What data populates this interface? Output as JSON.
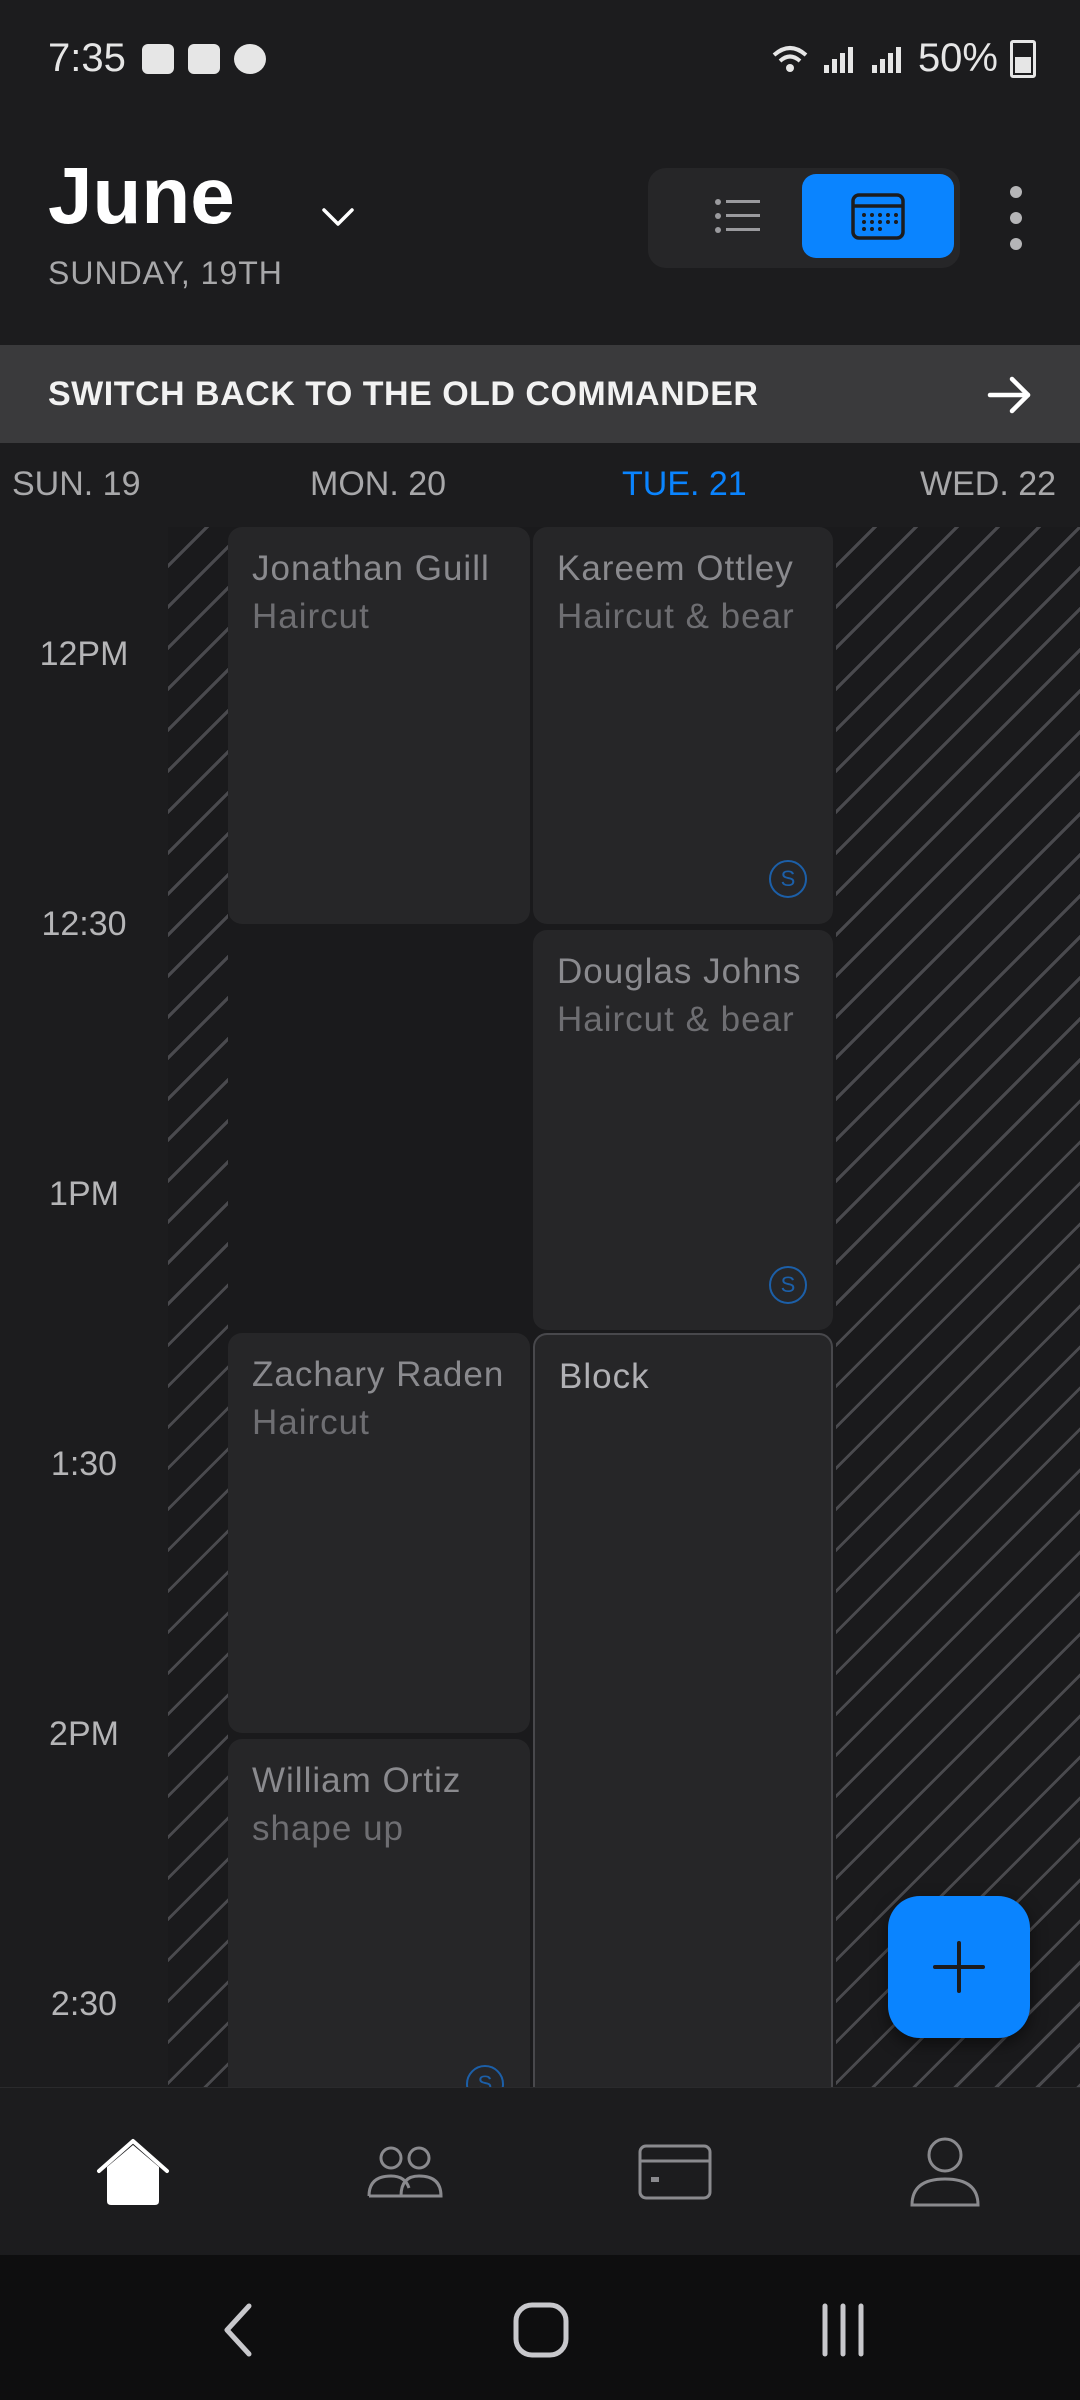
{
  "status_bar": {
    "time": "7:35",
    "battery": "50%",
    "icons": [
      "image-icon",
      "cibc-icon",
      "notification-app-icon",
      "wifi-icon",
      "signal-icon",
      "signal-roaming-icon",
      "battery-icon"
    ]
  },
  "header": {
    "month": "June",
    "date": "SUNDAY, 19TH",
    "view_toggle": {
      "list_icon": "list-icon",
      "calendar_icon": "calendar-icon",
      "active": "calendar"
    },
    "menu_icon": "kebab-menu-icon"
  },
  "banner": {
    "text": "SWITCH BACK TO THE OLD COMMANDER",
    "icon": "arrow-right-icon"
  },
  "days": [
    {
      "label": "SUN. 19",
      "today": false
    },
    {
      "label": "MON. 20",
      "today": false
    },
    {
      "label": "TUE. 21",
      "today": true
    },
    {
      "label": "WED. 22",
      "today": false
    }
  ],
  "time_labels": [
    "12PM",
    "12:30",
    "1PM",
    "1:30",
    "2PM",
    "2:30"
  ],
  "appointments": {
    "mon": [
      {
        "name": "Jonathan Guill",
        "service": "Haircut",
        "badge": ""
      },
      {
        "name": "Zachary Raden",
        "service": "Haircut",
        "badge": ""
      },
      {
        "name": "William Ortiz",
        "service": "shape up",
        "badge": "S"
      }
    ],
    "tue": [
      {
        "name": "Kareem Ottley",
        "service": "Haircut & bear",
        "badge": "S"
      },
      {
        "name": "Douglas Johns",
        "service": "Haircut & bear",
        "badge": "S"
      },
      {
        "name": "Block",
        "service": "",
        "badge": ""
      }
    ]
  },
  "colors": {
    "accent": "#0a84ff",
    "background": "#1c1c1e",
    "banner": "#3a3a3c",
    "card": "#262628"
  },
  "fab": {
    "icon": "plus-icon"
  },
  "bottom_nav": [
    {
      "id": "home",
      "icon": "home-icon",
      "active": true
    },
    {
      "id": "clients",
      "icon": "users-icon",
      "active": false
    },
    {
      "id": "payments",
      "icon": "card-icon",
      "active": false
    },
    {
      "id": "profile",
      "icon": "profile-icon",
      "active": false
    }
  ],
  "system_nav": [
    "back-icon",
    "home-circle-icon",
    "recents-icon"
  ]
}
